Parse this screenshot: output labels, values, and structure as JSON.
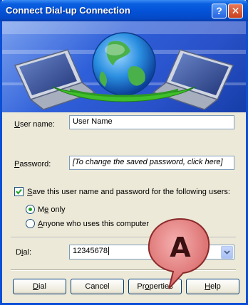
{
  "window": {
    "title": "Connect Dial-up Connection"
  },
  "titlebar": {
    "help_glyph": "?",
    "close_glyph": "✕"
  },
  "fields": {
    "user_name": {
      "label": "User name:",
      "accel": "U",
      "rest": "ser name:",
      "value": "User Name"
    },
    "password": {
      "label": "Password:",
      "accel": "P",
      "rest": "assword:",
      "value": "[To change the saved password, click here]"
    }
  },
  "save_credentials": {
    "checked": true,
    "accel": "S",
    "rest": "ave this user name and password for the following users:"
  },
  "users_option": {
    "me_only": {
      "accel": "e",
      "pre": "M",
      "rest": " only",
      "selected": true
    },
    "anyone": {
      "accel": "A",
      "rest": "nyone who uses this computer",
      "selected": false
    }
  },
  "dial": {
    "accel": "i",
    "pre": "D",
    "rest": "al:",
    "value": "12345678",
    "dropdown_icon": "chevron-down-icon"
  },
  "buttons": {
    "dial": {
      "accel": "D",
      "rest": "ial"
    },
    "cancel": {
      "label": "Cancel"
    },
    "properties": {
      "accel": "o",
      "pre": "Pr",
      "rest": "perties"
    },
    "help": {
      "accel": "H",
      "rest": "elp"
    }
  },
  "callout": {
    "label": "A",
    "color": "#e87c7c"
  },
  "colors": {
    "titlebar": "#0453d8",
    "dialog_bg": "#ece9d8",
    "radio_dot": "#21a121"
  }
}
